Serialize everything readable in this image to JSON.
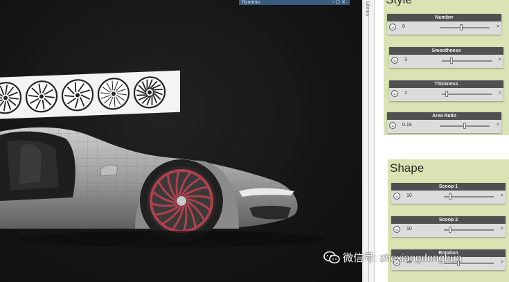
{
  "viewport": {
    "dynamo_label": "Dynamo",
    "window_buttons": "▫ ▢ ✕",
    "wheels": [
      {
        "spokes": 12,
        "style": "split"
      },
      {
        "spokes": 10,
        "style": "thin"
      },
      {
        "spokes": 9,
        "style": "blade"
      },
      {
        "spokes": 14,
        "style": "mesh"
      },
      {
        "spokes": 16,
        "style": "turbine"
      }
    ]
  },
  "side_tab": {
    "label": "Library"
  },
  "groups": [
    {
      "title": "Style",
      "nodes": [
        {
          "name": "Number",
          "value": "8",
          "fraction": 0.42
        },
        {
          "name": "Smoothness",
          "value": "3",
          "fraction": 0.18
        },
        {
          "name": "Thickness",
          "value": "2",
          "fraction": 0.08
        },
        {
          "name": "Area Ratio",
          "value": "0.18",
          "fraction": 0.5
        }
      ]
    },
    {
      "title": "Shape",
      "nodes": [
        {
          "name": "Scoop 1",
          "value": "10",
          "fraction": 0.1
        },
        {
          "name": "Scoop 2",
          "value": "10",
          "fraction": 0.1
        },
        {
          "name": "Rotation",
          "value": "28",
          "fraction": 0.28
        }
      ]
    }
  ],
  "watermark": {
    "text": "微信号: zhexiangdonghua",
    "icon": "wechat-icon"
  },
  "colors": {
    "group_bg": "#d9e3b3",
    "node_header": "#505050",
    "dynamo_bar": "#3a5c80",
    "rim": "#b2404c"
  }
}
